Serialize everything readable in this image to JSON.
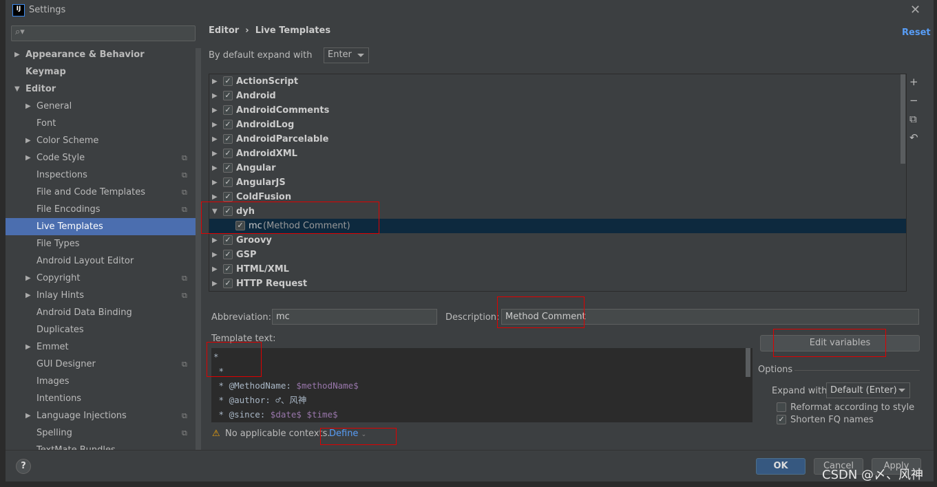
{
  "window": {
    "title": "Settings",
    "logo": "IJ",
    "close_icon": "close-icon"
  },
  "sidebar": {
    "search_placeholder": "",
    "items": [
      {
        "label": "Appearance & Behavior",
        "level": 0,
        "arrow": "right",
        "bold": true
      },
      {
        "label": "Keymap",
        "level": 0,
        "bold": true
      },
      {
        "label": "Editor",
        "level": 0,
        "arrow": "down",
        "bold": true
      },
      {
        "label": "General",
        "level": 1,
        "arrow": "right"
      },
      {
        "label": "Font",
        "level": 1
      },
      {
        "label": "Color Scheme",
        "level": 1,
        "arrow": "right"
      },
      {
        "label": "Code Style",
        "level": 1,
        "arrow": "right",
        "copy": true
      },
      {
        "label": "Inspections",
        "level": 1,
        "copy": true
      },
      {
        "label": "File and Code Templates",
        "level": 1,
        "copy": true
      },
      {
        "label": "File Encodings",
        "level": 1,
        "copy": true
      },
      {
        "label": "Live Templates",
        "level": 1,
        "selected": true
      },
      {
        "label": "File Types",
        "level": 1
      },
      {
        "label": "Android Layout Editor",
        "level": 1
      },
      {
        "label": "Copyright",
        "level": 1,
        "arrow": "right",
        "copy": true
      },
      {
        "label": "Inlay Hints",
        "level": 1,
        "arrow": "right",
        "copy": true
      },
      {
        "label": "Android Data Binding",
        "level": 1
      },
      {
        "label": "Duplicates",
        "level": 1
      },
      {
        "label": "Emmet",
        "level": 1,
        "arrow": "right"
      },
      {
        "label": "GUI Designer",
        "level": 1,
        "copy": true
      },
      {
        "label": "Images",
        "level": 1
      },
      {
        "label": "Intentions",
        "level": 1
      },
      {
        "label": "Language Injections",
        "level": 1,
        "arrow": "right",
        "copy": true
      },
      {
        "label": "Spelling",
        "level": 1,
        "copy": true
      },
      {
        "label": "TextMate Bundles",
        "level": 1
      }
    ]
  },
  "breadcrumb": {
    "parent": "Editor",
    "sep": "›",
    "current": "Live Templates"
  },
  "reset_label": "Reset",
  "expand": {
    "label": "By default expand with",
    "value": "Enter"
  },
  "tree": [
    {
      "label": "ActionScript",
      "checked": true
    },
    {
      "label": "Android",
      "checked": true
    },
    {
      "label": "AndroidComments",
      "checked": true
    },
    {
      "label": "AndroidLog",
      "checked": true
    },
    {
      "label": "AndroidParcelable",
      "checked": true
    },
    {
      "label": "AndroidXML",
      "checked": true
    },
    {
      "label": "Angular",
      "checked": true
    },
    {
      "label": "AngularJS",
      "checked": true
    },
    {
      "label": "ColdFusion",
      "checked": true
    },
    {
      "label": "dyh",
      "checked": true,
      "expanded": true
    },
    {
      "label": "mc",
      "desc": "(Method Comment)",
      "checked": true,
      "child": true,
      "selected": true
    },
    {
      "label": "Groovy",
      "checked": true
    },
    {
      "label": "GSP",
      "checked": true
    },
    {
      "label": "HTML/XML",
      "checked": true
    },
    {
      "label": "HTTP Request",
      "checked": true
    }
  ],
  "tree_tools": [
    "+",
    "−",
    "⧉",
    "↶"
  ],
  "abbreviation": {
    "label": "Abbreviation:",
    "value": "mc"
  },
  "description": {
    "label": "Description:",
    "value": "Method Comment"
  },
  "template_text": {
    "label": "Template text:",
    "lines": [
      [
        {
          "t": "*"
        }
      ],
      [
        {
          "t": " *"
        }
      ],
      [
        {
          "t": " * @MethodName: "
        },
        {
          "t": "$methodName$",
          "v": true
        }
      ],
      [
        {
          "t": " * @author: ♂、风神"
        }
      ],
      [
        {
          "t": " * @since: "
        },
        {
          "t": "$date$",
          "v": true
        },
        {
          "t": " "
        },
        {
          "t": "$time$",
          "v": true
        }
      ]
    ]
  },
  "edit_variables_label": "Edit variables",
  "options": {
    "title": "Options",
    "expand_label": "Expand with",
    "expand_value": "Default (Enter)",
    "reformat_label": "Reformat according to style",
    "reformat_checked": false,
    "shorten_label": "Shorten FQ names",
    "shorten_checked": true
  },
  "contexts": {
    "warning": "No applicable contexts.",
    "define": "Define"
  },
  "footer": {
    "help": "?",
    "ok": "OK",
    "cancel": "Cancel",
    "apply": "Apply"
  },
  "watermark": "CSDN @〆、风神",
  "colors": {
    "selection": "#4b6eaf",
    "tree_selection": "#0d293e",
    "link": "#589df6",
    "annotation": "#e00000"
  }
}
